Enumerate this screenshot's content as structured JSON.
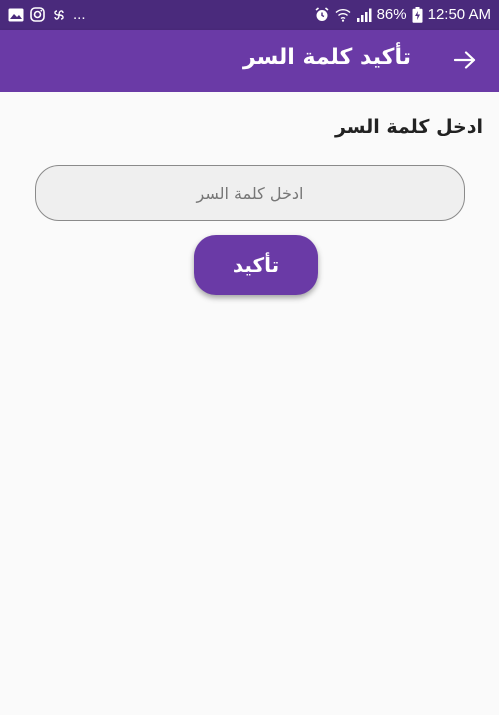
{
  "status_bar": {
    "overflow": "...",
    "battery": "86%",
    "time": "12:50 AM",
    "icons": [
      "gallery-icon",
      "instagram-icon",
      "pinwheel-icon",
      "alarm-icon",
      "wifi-icon",
      "signal-icon",
      "battery-icon"
    ]
  },
  "app_bar": {
    "title": "تأكيد كلمة السر",
    "back_icon": "arrow-icon"
  },
  "form": {
    "label": "ادخل كلمة السر",
    "input_placeholder": "ادخل كلمة السر",
    "input_value": "",
    "confirm_label": "تأكيد"
  },
  "colors": {
    "status_bar": "#4a2a7c",
    "primary": "#6a3aa6",
    "background": "#fafafa"
  }
}
